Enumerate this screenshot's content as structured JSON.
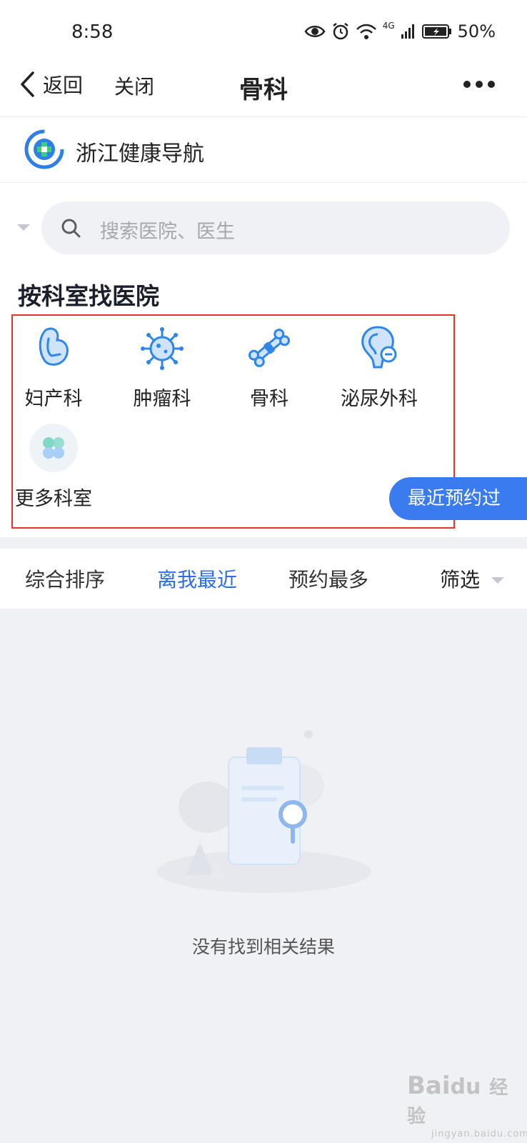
{
  "status_bar": {
    "time": "8:58",
    "network": "4G",
    "battery": "50%"
  },
  "nav": {
    "back_label": "返回",
    "close_label": "关闭",
    "title": "骨科"
  },
  "brand": {
    "name": "浙江健康导航"
  },
  "search": {
    "placeholder": "搜索医院、医生"
  },
  "section": {
    "title": "按科室找医院"
  },
  "departments": [
    {
      "label": "妇产科",
      "icon": "obstetrics-icon"
    },
    {
      "label": "肿瘤科",
      "icon": "oncology-virus-icon"
    },
    {
      "label": "骨科",
      "icon": "bone-icon"
    },
    {
      "label": "泌尿外科",
      "icon": "urology-icon"
    },
    {
      "label": "更多科室",
      "icon": "more-departments-icon"
    }
  ],
  "recent_button": {
    "label": "最近预约过"
  },
  "sort_bar": {
    "items": [
      "综合排序",
      "离我最近",
      "预约最多",
      "筛选"
    ],
    "active_index": 1
  },
  "empty_state": {
    "message": "没有找到相关结果"
  },
  "watermark": {
    "brand": "Bai",
    "brand2": "经验",
    "sub": "jingyan.baidu.com"
  },
  "colors": {
    "accent": "#3a7bf0",
    "highlight_border": "#e8322e",
    "background": "#f0f1f5"
  }
}
